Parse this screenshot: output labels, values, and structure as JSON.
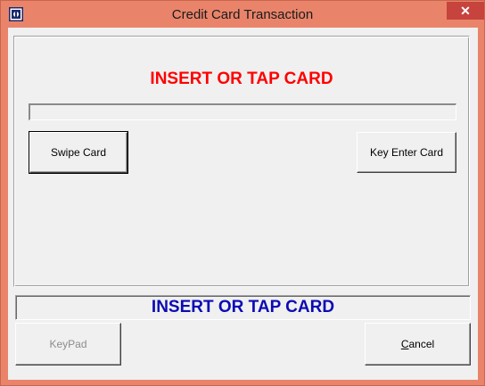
{
  "window": {
    "title": "Credit Card Transaction",
    "close_symbol": "✕",
    "frame_color": "#e9846b",
    "close_color": "#c7433d"
  },
  "main": {
    "headline": "INSERT OR TAP CARD",
    "headline_color": "#ff0000",
    "progress_value": 0,
    "swipe_label": "Swipe Card",
    "key_enter_label": "Key Enter Card"
  },
  "status": {
    "text": "INSERT OR TAP CARD",
    "color": "#0b0bb5"
  },
  "footer": {
    "keypad_label": "KeyPad",
    "cancel_label_first": "C",
    "cancel_label_rest": "ancel"
  },
  "icons": {
    "app": "app-icon",
    "close": "close-icon"
  }
}
